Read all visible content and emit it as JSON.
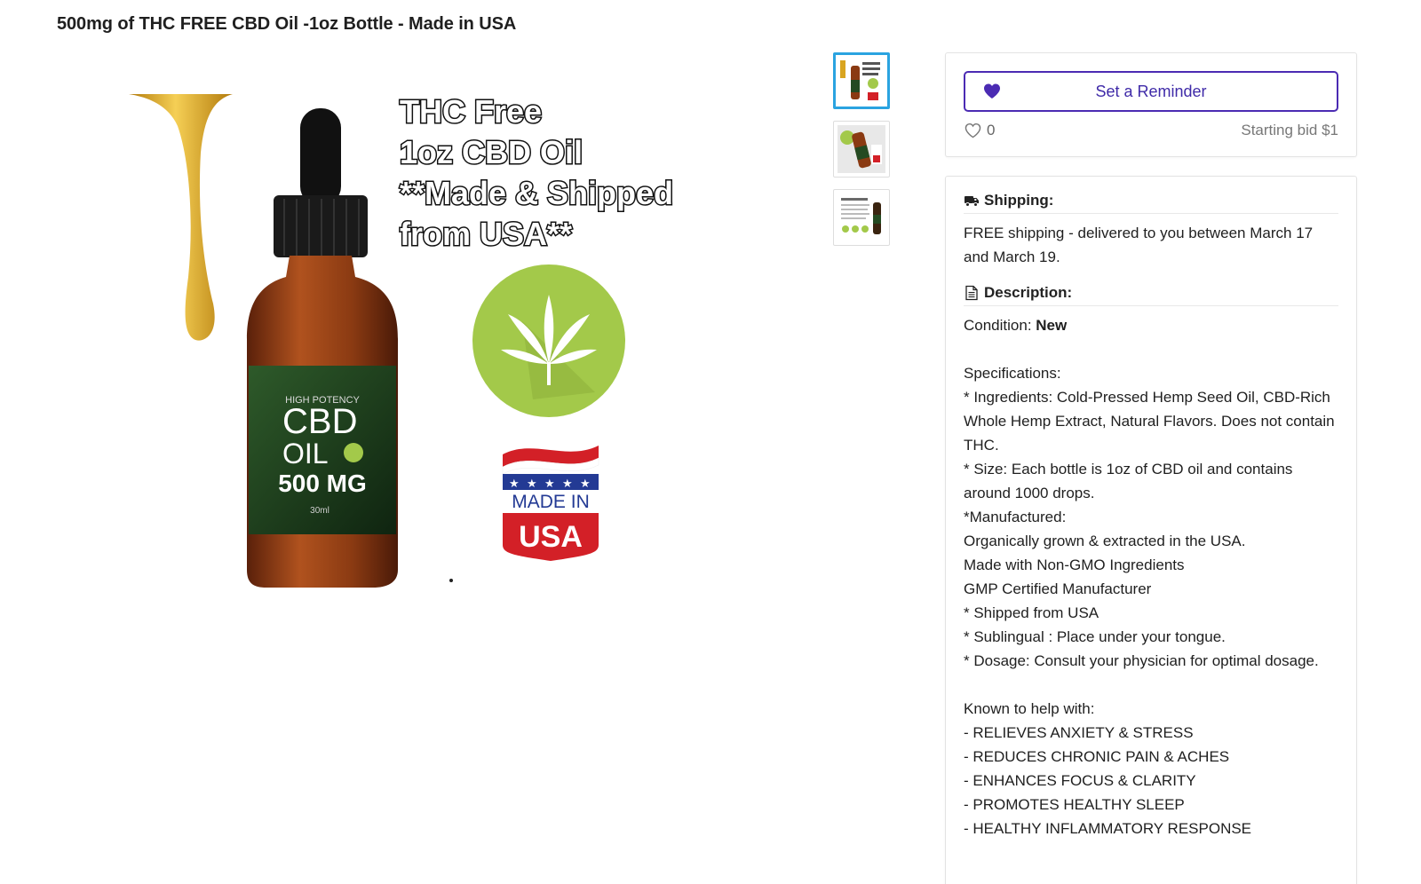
{
  "product": {
    "title": "500mg of THC FREE CBD Oil -1oz Bottle - Made in USA"
  },
  "image": {
    "headline_lines": [
      "THC Free",
      "1oz CBD Oil",
      "**Made & Shipped",
      "from USA**"
    ],
    "label_small": "HIGH POTENCY",
    "label_cbd": "CBD",
    "label_oil": "OIL",
    "label_mg": "500 MG",
    "label_ml": "30ml",
    "badge_made_in": "MADE IN",
    "badge_usa": "USA",
    "colors": {
      "oil": "#d9a520",
      "bottle": "#8a3a12",
      "leaf_circle": "#a3c94a",
      "usa_red": "#d32027",
      "usa_blue": "#233a94"
    }
  },
  "thumbnails": [
    {
      "name": "thumb-1",
      "active": true
    },
    {
      "name": "thumb-2",
      "active": false
    },
    {
      "name": "thumb-3",
      "active": false
    }
  ],
  "bid": {
    "reminder_label": "Set a Reminder",
    "likes_count": "0",
    "starting_bid": "Starting bid $1",
    "accent": "#4b2bb3"
  },
  "shipping": {
    "heading": "Shipping:",
    "icon": "truck-icon",
    "text": "FREE shipping - delivered to you between March 17 and March 19."
  },
  "description": {
    "heading": "Description:",
    "icon": "document-icon",
    "condition_label": "Condition: ",
    "condition_value": "New",
    "lines": [
      "",
      "Specifications:",
      "* Ingredients: Cold-Pressed Hemp Seed Oil, CBD-Rich Whole Hemp Extract, Natural Flavors. Does not contain THC.",
      "* Size: Each bottle is 1oz of CBD oil and contains around 1000 drops.",
      "*Manufactured:",
      "Organically grown & extracted in the USA.",
      "Made with Non-GMO Ingredients",
      "GMP Certified Manufacturer",
      "* Shipped from USA",
      "* Sublingual : Place under your tongue.",
      "* Dosage: Consult your physician for optimal dosage.",
      "",
      "Known to help with:",
      "- RELIEVES ANXIETY & STRESS",
      "- REDUCES CHRONIC PAIN & ACHES",
      "- ENHANCES FOCUS & CLARITY",
      "- PROMOTES HEALTHY SLEEP",
      "- HEALTHY INFLAMMATORY RESPONSE"
    ]
  }
}
